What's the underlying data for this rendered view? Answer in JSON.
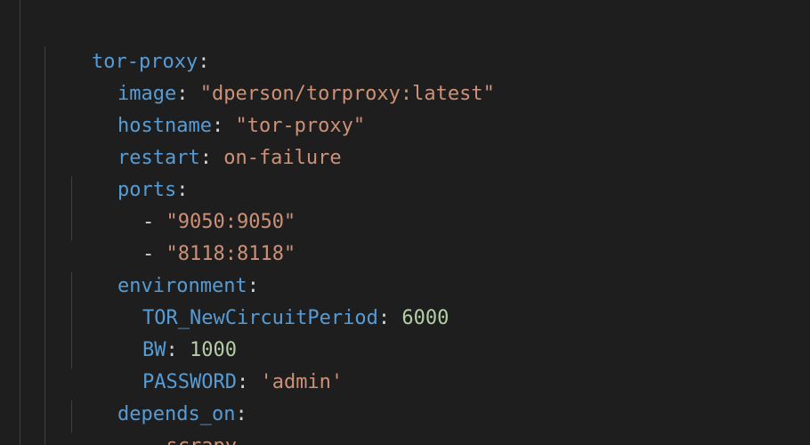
{
  "editor": {
    "lines": [
      {
        "key": "tor-proxy",
        "colon": ":"
      },
      {
        "key": "image",
        "colon": ":",
        "value": "\"dperson/torproxy:latest\""
      },
      {
        "key": "hostname",
        "colon": ":",
        "value": "\"tor-proxy\""
      },
      {
        "key": "restart",
        "colon": ":",
        "value": "on-failure"
      },
      {
        "key": "ports",
        "colon": ":"
      },
      {
        "dash": "-",
        "value": "\"9050:9050\""
      },
      {
        "dash": "-",
        "value": "\"8118:8118\""
      },
      {
        "key": "environment",
        "colon": ":"
      },
      {
        "key": "TOR_NewCircuitPeriod",
        "colon": ":",
        "value": "6000"
      },
      {
        "key": "BW",
        "colon": ":",
        "value": "1000"
      },
      {
        "key": "PASSWORD",
        "colon": ":",
        "value": "'admin'"
      },
      {
        "key": "depends_on",
        "colon": ":"
      },
      {
        "dash": "-",
        "value": "scrapy"
      }
    ]
  },
  "colors": {
    "background": "#1e1e1e",
    "key": "#569cd6",
    "string": "#ce9178",
    "number": "#b5cea8",
    "punctuation": "#d4d4d4",
    "indent_guide": "#404040"
  }
}
